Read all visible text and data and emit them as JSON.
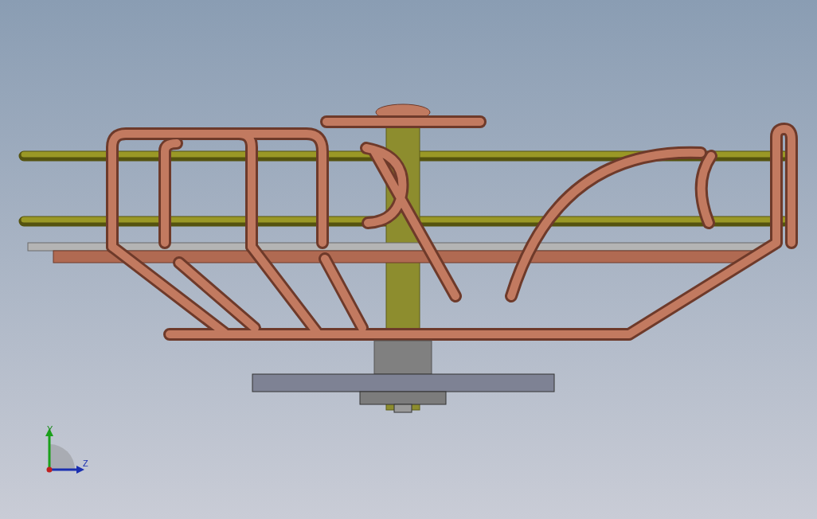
{
  "viewport": {
    "triad": {
      "axes": [
        {
          "label": "Y",
          "kind": "up"
        },
        {
          "label": "Z",
          "kind": "right"
        }
      ]
    }
  }
}
